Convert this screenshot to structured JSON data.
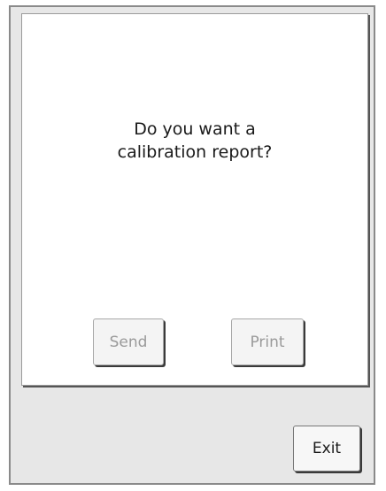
{
  "dialog": {
    "question_line1": "Do you want a",
    "question_line2": "calibration report?",
    "send_label": "Send",
    "print_label": "Print"
  },
  "footer": {
    "exit_label": "Exit"
  }
}
